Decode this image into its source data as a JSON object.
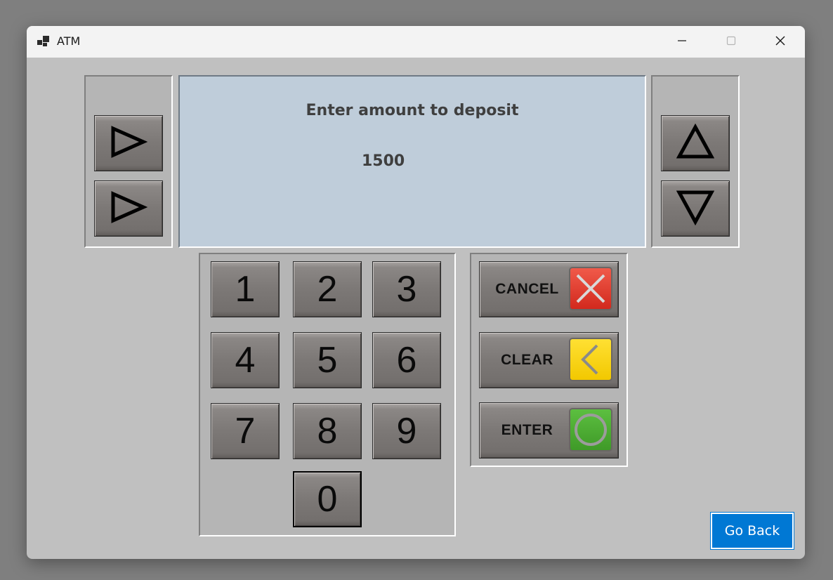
{
  "window": {
    "title": "ATM",
    "controls": {
      "minimize": "minimize-icon",
      "maximize": "maximize-icon",
      "close": "close-icon"
    }
  },
  "screen": {
    "prompt": "Enter amount to deposit",
    "amount": "1500"
  },
  "side_buttons": {
    "left": [
      "play-right-icon",
      "play-right-icon"
    ],
    "right": [
      "triangle-up-icon",
      "triangle-down-icon"
    ]
  },
  "keypad": {
    "keys": [
      "1",
      "2",
      "3",
      "4",
      "5",
      "6",
      "7",
      "8",
      "9",
      "0"
    ]
  },
  "actions": {
    "cancel": {
      "label": "CANCEL",
      "icon": "cancel-x-icon",
      "color": "#e23a2e"
    },
    "clear": {
      "label": "CLEAR",
      "icon": "clear-chevron-icon",
      "color": "#f5d000"
    },
    "enter": {
      "label": "ENTER",
      "icon": "enter-circle-icon",
      "color": "#4aa832"
    }
  },
  "go_back": {
    "label": "Go Back",
    "color": "#0078d4"
  }
}
